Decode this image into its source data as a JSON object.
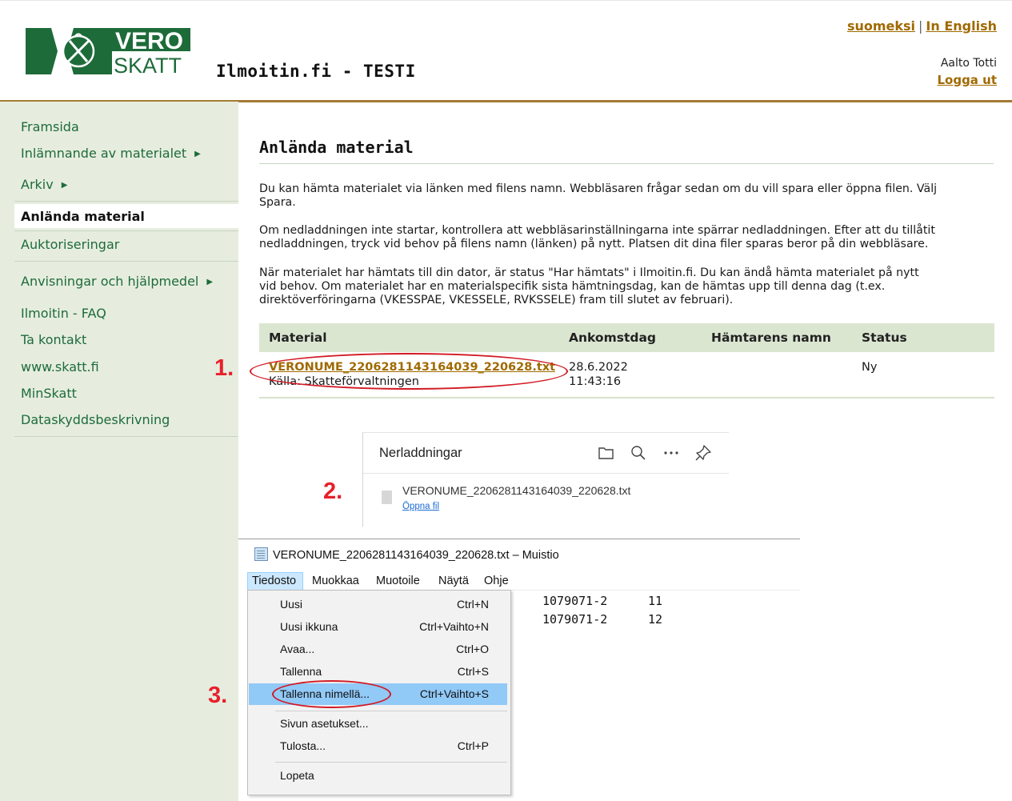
{
  "header": {
    "logo_line1": "VERO",
    "logo_line2": "SKATT",
    "site_title": "Ilmoitin.fi - TESTI",
    "lang_fi": "suomeksi",
    "lang_sep": "|",
    "lang_en": "In English",
    "user_name": "Aalto Totti",
    "logout": "Logga ut"
  },
  "sidebar": {
    "items": [
      {
        "label": "Framsida"
      },
      {
        "label": "Inlämnande av materialet",
        "arrow": "▶"
      },
      {
        "label": "Arkiv",
        "arrow": "▶"
      },
      {
        "label": "Anlända material"
      },
      {
        "label": "Auktoriseringar"
      },
      {
        "label": "Anvisningar och hjälpmedel",
        "arrow": "▶"
      },
      {
        "label": "Ilmoitin - FAQ"
      },
      {
        "label": "Ta kontakt"
      },
      {
        "label": "www.skatt.fi"
      },
      {
        "label": "MinSkatt"
      },
      {
        "label": "Dataskyddsbeskrivning"
      }
    ]
  },
  "main": {
    "title": "Anlända material",
    "para1_line1": "Du kan hämta materialet via länken med filens namn. Webbläsaren frågar sedan om du vill spara eller öppna filen. Välj",
    "para1_line2": "Spara.",
    "para2_line1": "Om nedladdningen inte startar, kontrollera att webbläsarinställningarna inte spärrar nedladdningen. Efter att du tillåtit",
    "para2_line2": "nedladdningen, tryck vid behov på filens namn (länken) på nytt. Platsen dit dina filer sparas beror på din webbläsare.",
    "para3_line1": "När materialet har hämtats till din dator, är status \"Har hämtats\" i Ilmoitin.fi. Du kan ändå hämta materialet på nytt",
    "para3_line2": "vid behov. Om materialet har en materialspecifik sista hämtningsdag, kan de hämtas upp till denna dag (t.ex.",
    "para3_line3": "direktöverföringarna (VKESSPAE, VKESSELE, RVKSSELE) fram till slutet av februari).",
    "table": {
      "headers": [
        "Material",
        "Ankomstdag",
        "Hämtarens namn",
        "Status"
      ],
      "rows": [
        {
          "file": "VERONUME_2206281143164039_220628.txt",
          "source": "Källa: Skatteförvaltningen",
          "date": "28.6.2022",
          "time": "11:43:16",
          "fetcher": "",
          "status": "Ny"
        }
      ]
    }
  },
  "steps": [
    "1.",
    "2.",
    "3."
  ],
  "downloads": {
    "title": "Nerladdningar",
    "icons": [
      "folder-icon",
      "search-icon",
      "more-icon",
      "pin-icon"
    ],
    "file_name": "VERONUME_2206281143164039_220628.txt",
    "open_label": "Öppna fil"
  },
  "notepad": {
    "title": "VERONUME_2206281143164039_220628.txt – Muistio",
    "menubar": [
      "Tiedosto",
      "Muokkaa",
      "Muotoile",
      "Näytä",
      "Ohje"
    ],
    "content_lines": [
      {
        "id": "1079071-2",
        "num": "11"
      },
      {
        "id": "1079071-2",
        "num": "12"
      }
    ],
    "file_menu": [
      {
        "label": "Uusi",
        "shortcut": "Ctrl+N"
      },
      {
        "label": "Uusi ikkuna",
        "shortcut": "Ctrl+Vaihto+N"
      },
      {
        "label": "Avaa...",
        "shortcut": "Ctrl+O"
      },
      {
        "label": "Tallenna",
        "shortcut": "Ctrl+S"
      },
      {
        "label": "Tallenna nimellä...",
        "shortcut": "Ctrl+Vaihto+S"
      },
      {
        "label": "Sivun asetukset...",
        "shortcut": ""
      },
      {
        "label": "Tulosta...",
        "shortcut": "Ctrl+P"
      },
      {
        "label": "Lopeta",
        "shortcut": ""
      }
    ]
  },
  "colors": {
    "brand_green": "#1e6b3a",
    "header_rule": "#a37a36",
    "link": "#a06a00",
    "sidebar_bg": "#e6eddf",
    "annotation_red": "#d11b24",
    "menu_highlight": "#91c9f7"
  }
}
